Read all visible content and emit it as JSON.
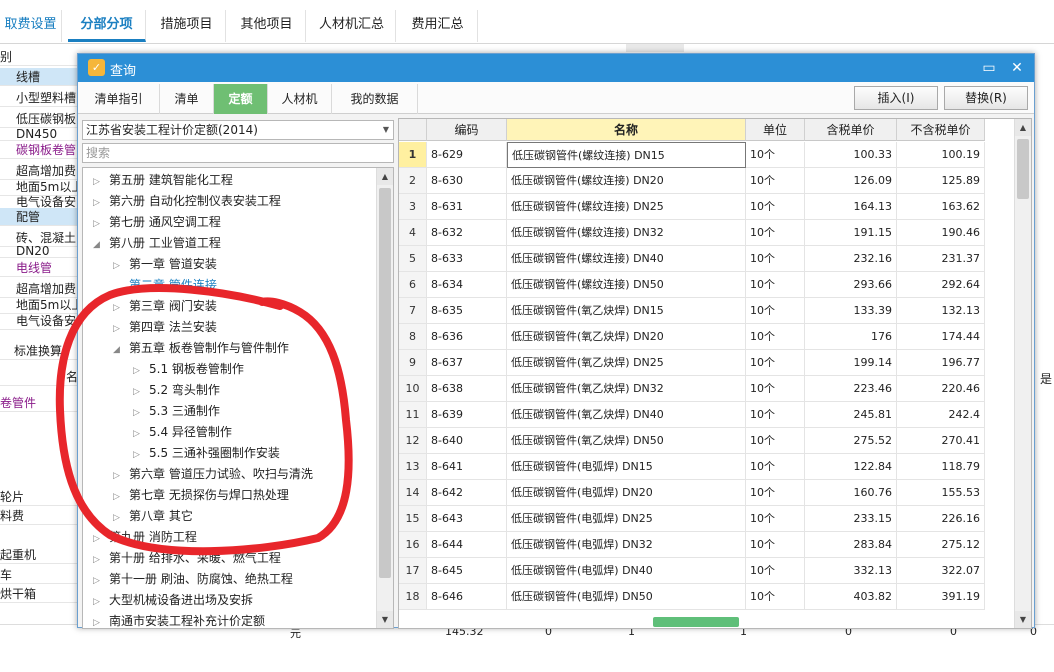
{
  "app_tabs": [
    "取费设置",
    "分部分项",
    "措施项目",
    "其他项目",
    "人材机汇总",
    "费用汇总"
  ],
  "bg_rows": [
    "别",
    "线槽",
    "小型塑料槽",
    "低压碳钢板",
    "DN450",
    "碳钢板卷管",
    "超高增加费",
    "地面5m以上",
    "电气设备安",
    "配管",
    "砖、混凝土",
    "DN20",
    "电线管",
    "超高增加费",
    "地面5m以上",
    "电气设备安",
    "标准换算",
    "名",
    "卷管件",
    "轮片",
    "料费",
    "起重机",
    "车",
    "烘干箱"
  ],
  "bg_footer": {
    "unit": "元",
    "v1": "145.32",
    "v2": "0",
    "v3": "1",
    "v4": "1",
    "v5": "0",
    "v6": "0",
    "v7": "0"
  },
  "bg_right_label": "是",
  "dialog": {
    "title": "查询",
    "tabs": [
      "清单指引",
      "清单",
      "定额",
      "人材机",
      "我的数据"
    ],
    "active_tab": "定额",
    "insert_label": "插入(I)",
    "replace_label": "替换(R)",
    "quota_set": "江苏省安装工程计价定额(2014)",
    "search_placeholder": "搜索"
  },
  "tree": [
    {
      "label": "第五册 建筑智能化工程",
      "level": 0,
      "exp": "closed"
    },
    {
      "label": "第六册 自动化控制仪表安装工程",
      "level": 0,
      "exp": "closed"
    },
    {
      "label": "第七册 通风空调工程",
      "level": 0,
      "exp": "closed"
    },
    {
      "label": "第八册 工业管道工程",
      "level": 0,
      "exp": "open"
    },
    {
      "label": "第一章 管道安装",
      "level": 1,
      "exp": "closed"
    },
    {
      "label": "第二章 管件连接",
      "level": 1,
      "exp": "none",
      "selected": true
    },
    {
      "label": "第三章 阀门安装",
      "level": 1,
      "exp": "closed"
    },
    {
      "label": "第四章 法兰安装",
      "level": 1,
      "exp": "closed"
    },
    {
      "label": "第五章 板卷管制作与管件制作",
      "level": 1,
      "exp": "open"
    },
    {
      "label": "5.1 钢板卷管制作",
      "level": 2,
      "exp": "closed"
    },
    {
      "label": "5.2 弯头制作",
      "level": 2,
      "exp": "closed"
    },
    {
      "label": "5.3 三通制作",
      "level": 2,
      "exp": "closed"
    },
    {
      "label": "5.4 异径管制作",
      "level": 2,
      "exp": "closed"
    },
    {
      "label": "5.5 三通补强圈制作安装",
      "level": 2,
      "exp": "closed"
    },
    {
      "label": "第六章 管道压力试验、吹扫与清洗",
      "level": 1,
      "exp": "closed"
    },
    {
      "label": "第七章 无损探伤与焊口热处理",
      "level": 1,
      "exp": "closed"
    },
    {
      "label": "第八章 其它",
      "level": 1,
      "exp": "closed"
    },
    {
      "label": "第九册 消防工程",
      "level": 0,
      "exp": "closed"
    },
    {
      "label": "第十册 给排水、采暖、燃气工程",
      "level": 0,
      "exp": "closed"
    },
    {
      "label": "第十一册 刷油、防腐蚀、绝热工程",
      "level": 0,
      "exp": "closed"
    },
    {
      "label": "大型机械设备进出场及安拆",
      "level": 0,
      "exp": "closed"
    },
    {
      "label": "南通市安装工程补充计价定额",
      "level": 0,
      "exp": "closed"
    }
  ],
  "grid_headers": [
    "",
    "编码",
    "名称",
    "单位",
    "含税单价",
    "不含税单价"
  ],
  "rows": [
    {
      "idx": "1",
      "code": "8-629",
      "name": "低压碳钢管件(螺纹连接) DN15",
      "unit": "10个",
      "p1": "100.33",
      "p2": "100.19"
    },
    {
      "idx": "2",
      "code": "8-630",
      "name": "低压碳钢管件(螺纹连接) DN20",
      "unit": "10个",
      "p1": "126.09",
      "p2": "125.89"
    },
    {
      "idx": "3",
      "code": "8-631",
      "name": "低压碳钢管件(螺纹连接) DN25",
      "unit": "10个",
      "p1": "164.13",
      "p2": "163.62"
    },
    {
      "idx": "4",
      "code": "8-632",
      "name": "低压碳钢管件(螺纹连接) DN32",
      "unit": "10个",
      "p1": "191.15",
      "p2": "190.46"
    },
    {
      "idx": "5",
      "code": "8-633",
      "name": "低压碳钢管件(螺纹连接) DN40",
      "unit": "10个",
      "p1": "232.16",
      "p2": "231.37"
    },
    {
      "idx": "6",
      "code": "8-634",
      "name": "低压碳钢管件(螺纹连接) DN50",
      "unit": "10个",
      "p1": "293.66",
      "p2": "292.64"
    },
    {
      "idx": "7",
      "code": "8-635",
      "name": "低压碳钢管件(氧乙炔焊) DN15",
      "unit": "10个",
      "p1": "133.39",
      "p2": "132.13"
    },
    {
      "idx": "8",
      "code": "8-636",
      "name": "低压碳钢管件(氧乙炔焊) DN20",
      "unit": "10个",
      "p1": "176",
      "p2": "174.44"
    },
    {
      "idx": "9",
      "code": "8-637",
      "name": "低压碳钢管件(氧乙炔焊) DN25",
      "unit": "10个",
      "p1": "199.14",
      "p2": "196.77"
    },
    {
      "idx": "10",
      "code": "8-638",
      "name": "低压碳钢管件(氧乙炔焊) DN32",
      "unit": "10个",
      "p1": "223.46",
      "p2": "220.46"
    },
    {
      "idx": "11",
      "code": "8-639",
      "name": "低压碳钢管件(氧乙炔焊) DN40",
      "unit": "10个",
      "p1": "245.81",
      "p2": "242.4"
    },
    {
      "idx": "12",
      "code": "8-640",
      "name": "低压碳钢管件(氧乙炔焊) DN50",
      "unit": "10个",
      "p1": "275.52",
      "p2": "270.41"
    },
    {
      "idx": "13",
      "code": "8-641",
      "name": "低压碳钢管件(电弧焊) DN15",
      "unit": "10个",
      "p1": "122.84",
      "p2": "118.79"
    },
    {
      "idx": "14",
      "code": "8-642",
      "name": "低压碳钢管件(电弧焊) DN20",
      "unit": "10个",
      "p1": "160.76",
      "p2": "155.53"
    },
    {
      "idx": "15",
      "code": "8-643",
      "name": "低压碳钢管件(电弧焊) DN25",
      "unit": "10个",
      "p1": "233.15",
      "p2": "226.16"
    },
    {
      "idx": "16",
      "code": "8-644",
      "name": "低压碳钢管件(电弧焊) DN32",
      "unit": "10个",
      "p1": "283.84",
      "p2": "275.12"
    },
    {
      "idx": "17",
      "code": "8-645",
      "name": "低压碳钢管件(电弧焊) DN40",
      "unit": "10个",
      "p1": "332.13",
      "p2": "322.07"
    },
    {
      "idx": "18",
      "code": "8-646",
      "name": "低压碳钢管件(电弧焊) DN50",
      "unit": "10个",
      "p1": "403.82",
      "p2": "391.19"
    }
  ],
  "colors": {
    "accent": "#2c8fd6",
    "active_tab": "#6fbf73",
    "header_highlight": "#fff4b8",
    "annotation": "#e8262b"
  }
}
